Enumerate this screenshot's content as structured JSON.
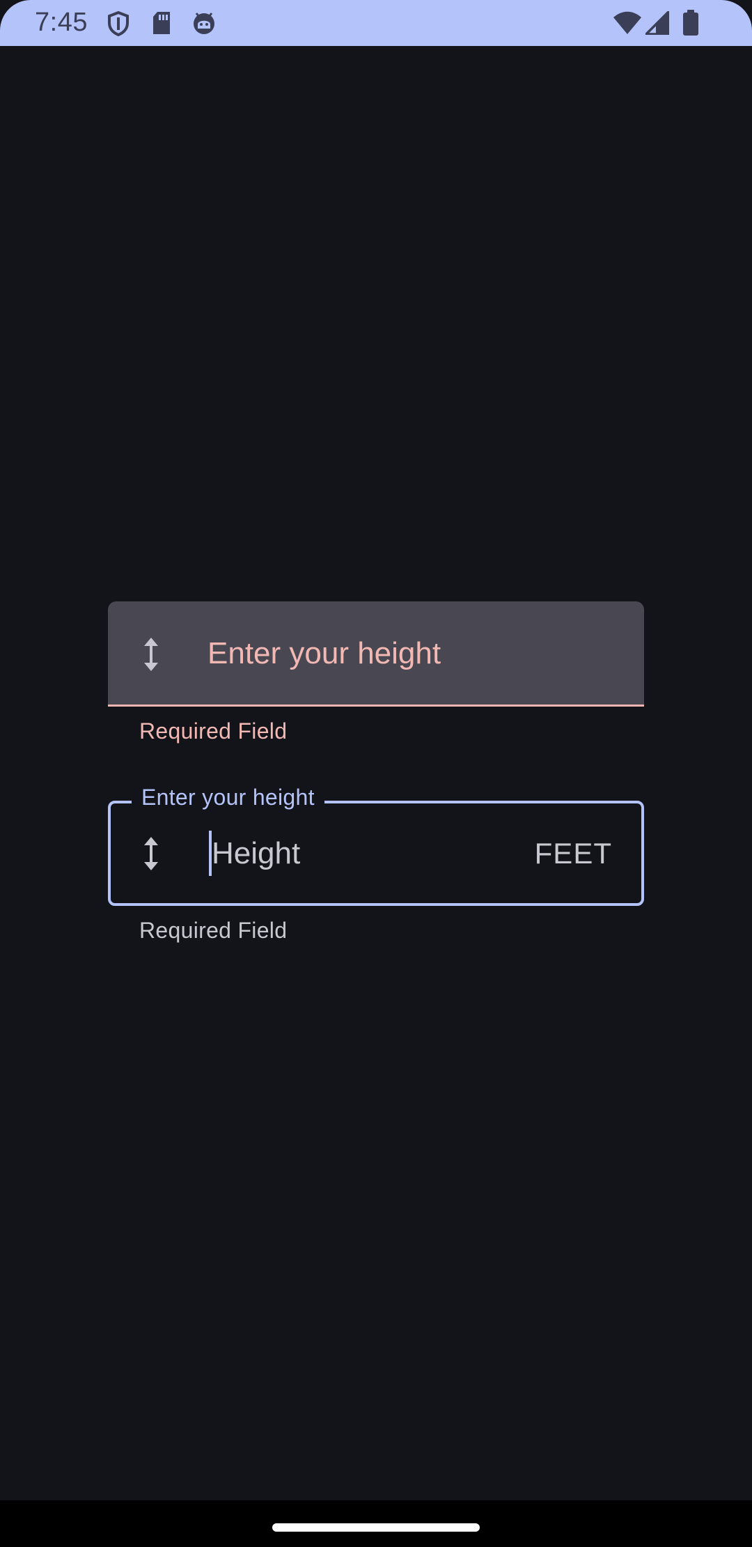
{
  "status_bar": {
    "time": "7:45",
    "icons": [
      "shield-icon",
      "sd-card-icon",
      "android-debug-icon",
      "wifi-icon",
      "cellular-signal-icon",
      "battery-icon"
    ]
  },
  "filled_field": {
    "label": "Enter your height",
    "supporting_text": "Required Field",
    "icon": "height-icon",
    "state": "error"
  },
  "outlined_field": {
    "label": "Enter your height",
    "value": "",
    "placeholder": "Height",
    "suffix": "FEET",
    "supporting_text": "Required Field",
    "icon": "height-icon",
    "state": "focused"
  },
  "colors": {
    "background": "#131419",
    "status_bar": "#b4c4fb",
    "primary": "#b4c4fb",
    "error": "#f2b8b4",
    "filled_container": "#494852",
    "on_surface_variant": "#c9c7d0"
  }
}
